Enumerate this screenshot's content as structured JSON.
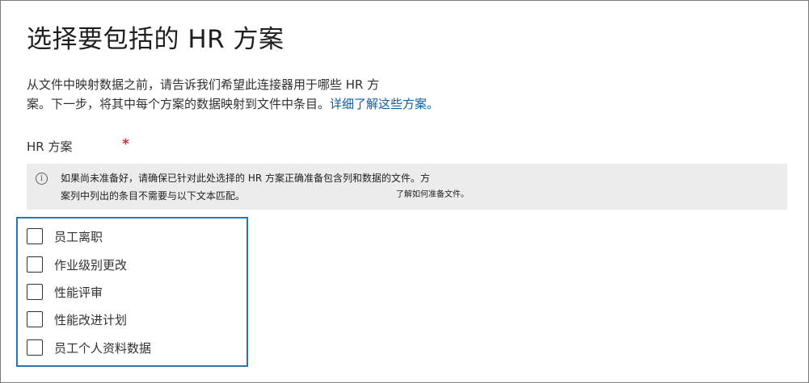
{
  "page": {
    "title": "选择要包括的 HR 方案",
    "description_line1": "从文件中映射数据之前，请告诉我们希望此连接器用于哪些 HR 方",
    "description_line2_prefix": "案。下一步，将其中每个方案的数据映射到文件中条目。",
    "description_link": "详细了解这些方案。"
  },
  "field": {
    "label": "HR 方案",
    "required_marker": "*"
  },
  "info_bar": {
    "icon": "info-icon",
    "icon_glyph": "i",
    "line1": "如果尚未准备好，请确保已针对此处选择的 HR 方案正确准备包含列和数据的文件。方",
    "line2": "案列中列出的条目不需要与以下文本匹配。",
    "link": "了解如何准备文件。"
  },
  "options": [
    {
      "label": "员工离职",
      "checked": false
    },
    {
      "label": "作业级别更改",
      "checked": false
    },
    {
      "label": "性能评审",
      "checked": false
    },
    {
      "label": "性能改进计划",
      "checked": false
    },
    {
      "label": "员工个人资料数据",
      "checked": false
    }
  ],
  "colors": {
    "required": "#d13438",
    "link": "#0f5ca8",
    "focus_border": "#2b73b3",
    "info_background": "#ececec"
  }
}
